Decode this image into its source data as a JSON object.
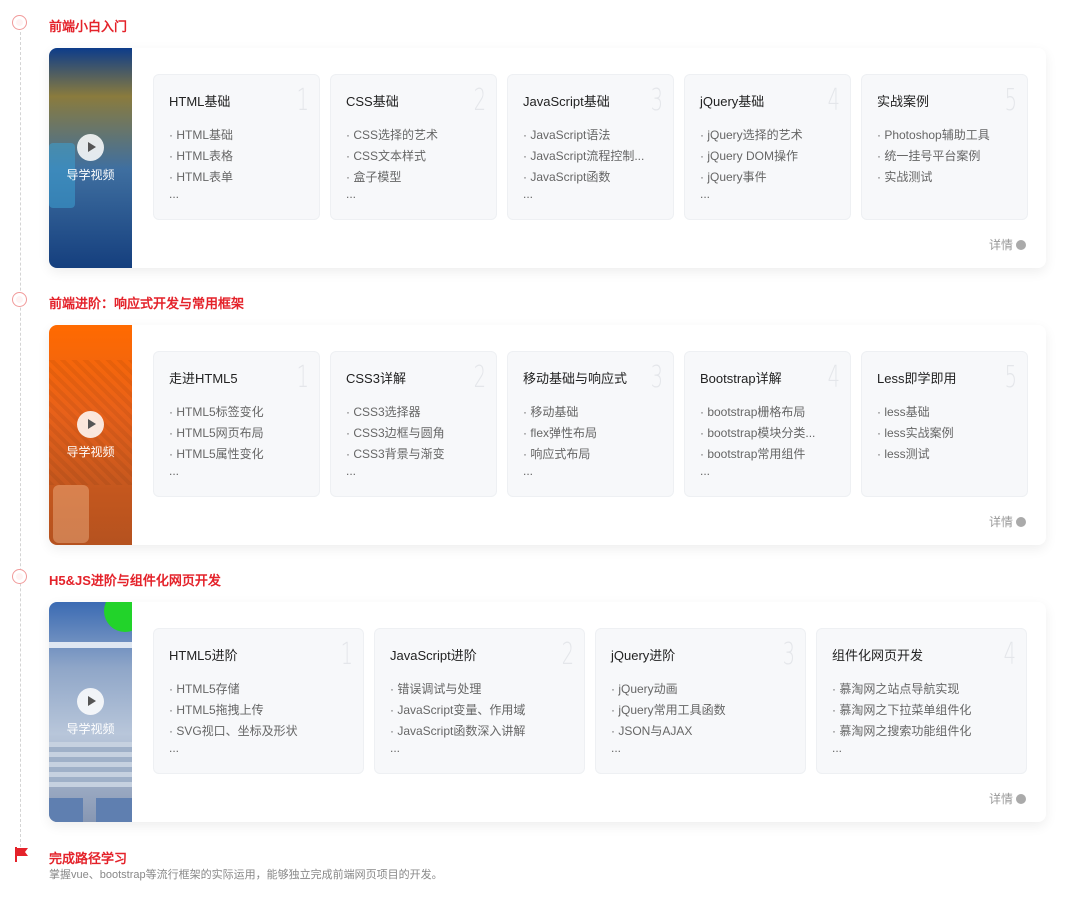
{
  "stages": [
    {
      "title": "前端小白入门",
      "video_label": "导学视频",
      "details_label": "详情",
      "courses": [
        {
          "num": "1",
          "title": "HTML基础",
          "items": [
            "· HTML基础",
            "· HTML表格",
            "· HTML表单"
          ],
          "more": "..."
        },
        {
          "num": "2",
          "title": "CSS基础",
          "items": [
            "· CSS选择的艺术",
            "· CSS文本样式",
            "· 盒子模型"
          ],
          "more": "..."
        },
        {
          "num": "3",
          "title": "JavaScript基础",
          "items": [
            "· JavaScript语法",
            "· JavaScript流程控制...",
            "· JavaScript函数"
          ],
          "more": "..."
        },
        {
          "num": "4",
          "title": "jQuery基础",
          "items": [
            "· jQuery选择的艺术",
            "· jQuery DOM操作",
            "· jQuery事件"
          ],
          "more": "..."
        },
        {
          "num": "5",
          "title": "实战案例",
          "items": [
            "· Photoshop辅助工具",
            "· 统一挂号平台案例",
            "· 实战测试"
          ],
          "more": ""
        }
      ]
    },
    {
      "title": "前端进阶：响应式开发与常用框架",
      "video_label": "导学视频",
      "details_label": "详情",
      "courses": [
        {
          "num": "1",
          "title": "走进HTML5",
          "items": [
            "· HTML5标签变化",
            "· HTML5网页布局",
            "· HTML5属性变化"
          ],
          "more": "..."
        },
        {
          "num": "2",
          "title": "CSS3详解",
          "items": [
            "· CSS3选择器",
            "· CSS3边框与圆角",
            "· CSS3背景与渐变"
          ],
          "more": "..."
        },
        {
          "num": "3",
          "title": "移动基础与响应式",
          "items": [
            "· 移动基础",
            "· flex弹性布局",
            "· 响应式布局"
          ],
          "more": "..."
        },
        {
          "num": "4",
          "title": "Bootstrap详解",
          "items": [
            "· bootstrap栅格布局",
            "· bootstrap模块分类...",
            "· bootstrap常用组件"
          ],
          "more": "..."
        },
        {
          "num": "5",
          "title": "Less即学即用",
          "items": [
            "· less基础",
            "· less实战案例",
            "· less测试"
          ],
          "more": ""
        }
      ]
    },
    {
      "title": "H5&JS进阶与组件化网页开发",
      "video_label": "导学视频",
      "details_label": "详情",
      "courses": [
        {
          "num": "1",
          "title": "HTML5进阶",
          "items": [
            "· HTML5存储",
            "· HTML5拖拽上传",
            "· SVG视口、坐标及形状"
          ],
          "more": "..."
        },
        {
          "num": "2",
          "title": "JavaScript进阶",
          "items": [
            "· 错误调试与处理",
            "· JavaScript变量、作用域",
            "· JavaScript函数深入讲解"
          ],
          "more": "..."
        },
        {
          "num": "3",
          "title": "jQuery进阶",
          "items": [
            "· jQuery动画",
            "· jQuery常用工具函数",
            "· JSON与AJAX"
          ],
          "more": "..."
        },
        {
          "num": "4",
          "title": "组件化网页开发",
          "items": [
            "· 慕淘网之站点导航实现",
            "· 慕淘网之下拉菜单组件化",
            "· 慕淘网之搜索功能组件化"
          ],
          "more": "..."
        }
      ]
    }
  ],
  "finish": {
    "title": "完成路径学习",
    "desc": "掌握vue、bootstrap等流行框架的实际运用，能够独立完成前端网页项目的开发。"
  }
}
